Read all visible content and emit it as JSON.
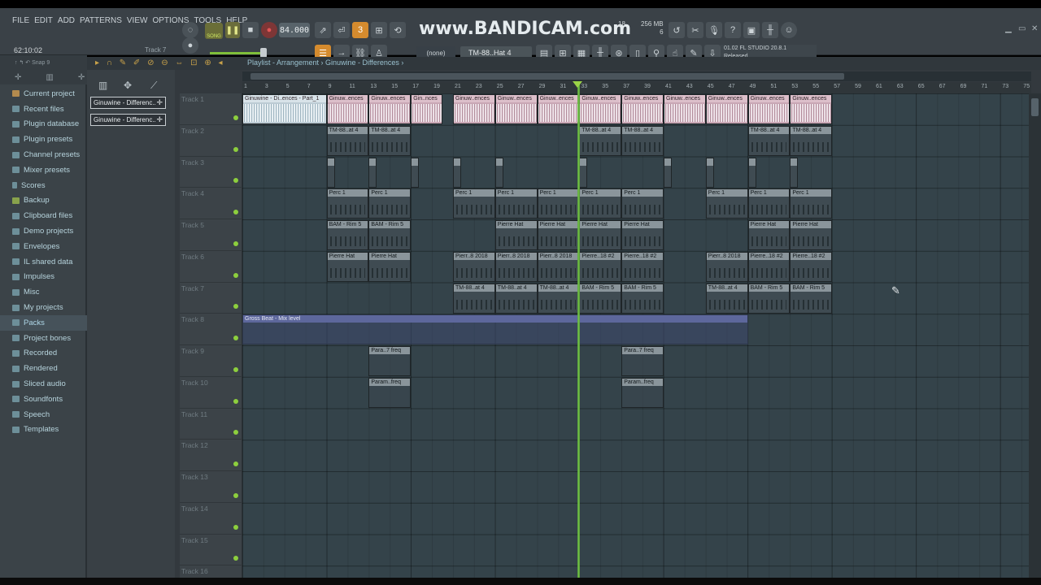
{
  "menu": [
    "FILE",
    "EDIT",
    "ADD",
    "PATTERNS",
    "VIEW",
    "OPTIONS",
    "TOOLS",
    "HELP"
  ],
  "hint": {
    "time": "62:10:02",
    "track": "Track 7"
  },
  "transport": {
    "mode_label": "SONG",
    "tempo": "84.000"
  },
  "watermark": "www.BANDICAM.com",
  "cpu": {
    "cpu": "18",
    "ram": "256 MB",
    "poly": "6"
  },
  "pattern_selector": "(none)",
  "channel_selector": "TM-88..Hat 4",
  "news": {
    "line1": "01.02  FL STUDIO 20.8.1",
    "line2": "Released"
  },
  "browser": {
    "snap": "Snap 9",
    "items": [
      {
        "label": "Current project",
        "icon": "project-icon"
      },
      {
        "label": "Recent files",
        "icon": "folder-icon"
      },
      {
        "label": "Plugin database",
        "icon": "plug-icon"
      },
      {
        "label": "Plugin presets",
        "icon": "plug-icon"
      },
      {
        "label": "Channel presets",
        "icon": "folder-icon"
      },
      {
        "label": "Mixer presets",
        "icon": "folder-icon"
      },
      {
        "label": "Scores",
        "icon": "note-icon"
      },
      {
        "label": "Backup",
        "icon": "folder-icon"
      },
      {
        "label": "Clipboard files",
        "icon": "folder-icon"
      },
      {
        "label": "Demo projects",
        "icon": "folder-icon"
      },
      {
        "label": "Envelopes",
        "icon": "folder-icon"
      },
      {
        "label": "IL shared data",
        "icon": "folder-icon"
      },
      {
        "label": "Impulses",
        "icon": "folder-icon"
      },
      {
        "label": "Misc",
        "icon": "folder-icon"
      },
      {
        "label": "My projects",
        "icon": "folder-icon"
      },
      {
        "label": "Packs",
        "icon": "folder-icon"
      },
      {
        "label": "Project bones",
        "icon": "folder-icon"
      },
      {
        "label": "Recorded",
        "icon": "plus-icon"
      },
      {
        "label": "Rendered",
        "icon": "plus-icon"
      },
      {
        "label": "Sliced audio",
        "icon": "plus-icon"
      },
      {
        "label": "Soundfonts",
        "icon": "folder-icon"
      },
      {
        "label": "Speech",
        "icon": "folder-icon"
      },
      {
        "label": "Templates",
        "icon": "folder-icon"
      }
    ]
  },
  "playlist": {
    "title": "Playlist - Arrangement › Ginuwine - Differences ›",
    "clip_list": [
      "Ginuwine - Differenc..",
      "Ginuwine - Differenc.."
    ],
    "tracks": [
      "Track 1",
      "Track 2",
      "Track 3",
      "Track 4",
      "Track 5",
      "Track 6",
      "Track 7",
      "Track 8",
      "Track 9",
      "Track 10",
      "Track 11",
      "Track 12",
      "Track 13",
      "Track 14",
      "Track 15",
      "Track 16"
    ],
    "ruler": [
      "1",
      "3",
      "5",
      "7",
      "9",
      "11",
      "13",
      "15",
      "17",
      "19",
      "21",
      "23",
      "25",
      "27",
      "29",
      "31",
      "33",
      "35",
      "37",
      "39",
      "41",
      "43",
      "45",
      "47",
      "49",
      "51",
      "53",
      "55",
      "57",
      "59",
      "61",
      "63",
      "65",
      "67",
      "69",
      "71",
      "73",
      "75"
    ]
  },
  "clips": {
    "audio_first": "Ginuwine - Di..ences - Part_1",
    "audio": "Ginuw..ences",
    "audio_short": "Gin..nces",
    "tm": "TM-88..at 4",
    "perc": "Perc 1",
    "bam": "BAM - Rim 5",
    "pierre": "Pierre Hat",
    "pierr2018": "Pierr..8 2018",
    "pierr18": "Pierre..18 #2",
    "gross": "Gross Beat - Mix level",
    "para": "Para..7 freq",
    "param": "Param..freq"
  }
}
